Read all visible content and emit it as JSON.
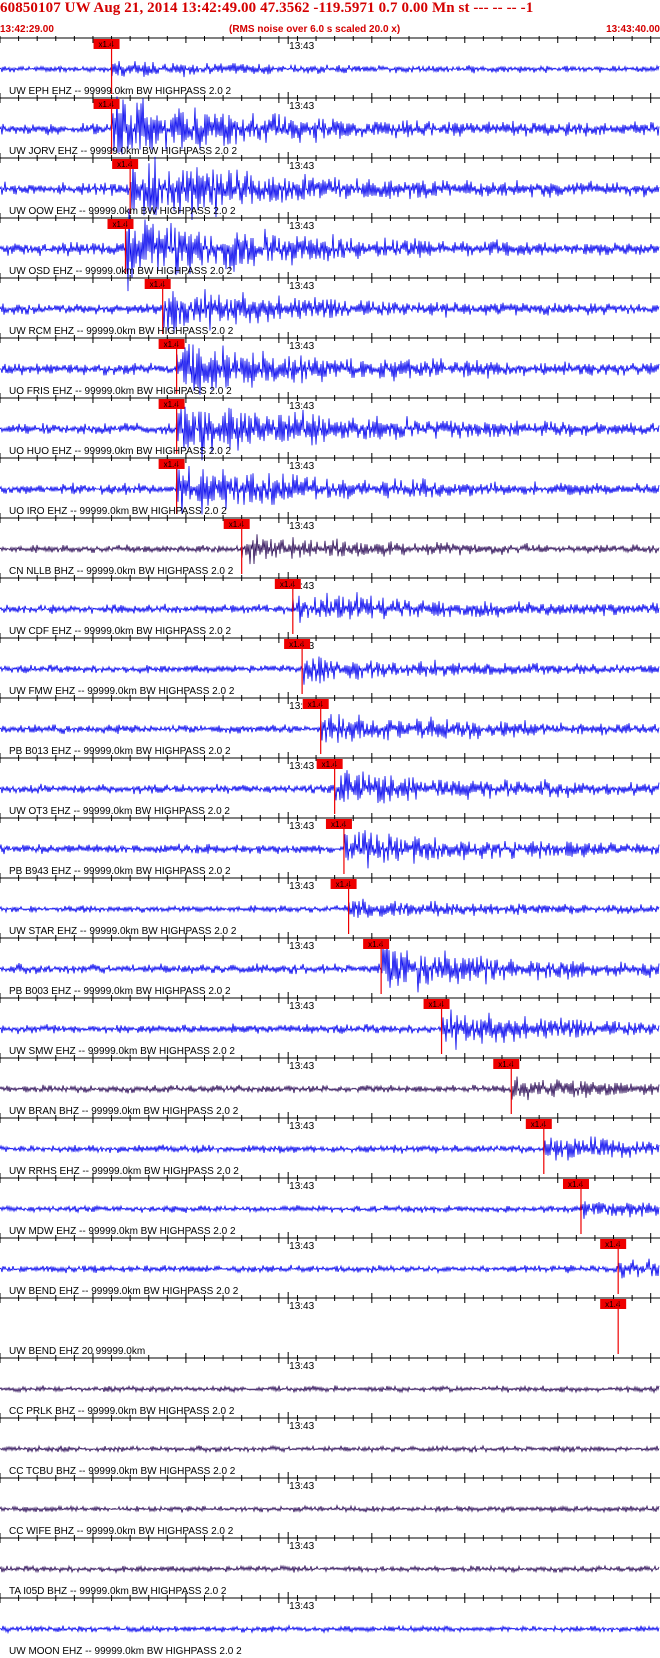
{
  "header": {
    "title": "60850107 UW Aug 21, 2014 13:42:49.00   47.3562 -119.5971  0.7 0.00 Mn st --- -- --  -1",
    "start_time": "13:42:29.00",
    "subtitle": "(RMS noise over 6.0 s scaled 20.0 x)",
    "end_time": "13:43:40.00"
  },
  "colors": {
    "header_text": "#d40000",
    "trace_blue": "#0000ee",
    "trace_purple": "#2a0a55",
    "pick": "#ee0000",
    "axis": "#000000"
  },
  "chart_data": {
    "type": "line",
    "title": "60850107 UW Aug 21, 2014 13:42:49.00",
    "x_unit": "seconds",
    "x_range": [
      "13:42:29.00",
      "13:43:40.00"
    ],
    "minute_tick_label": "13:43",
    "pick_label": "x1.4",
    "traces": [
      {
        "label": "UW EPH EHZ -- 99999.0km BW  HIGHPASS  2.0  2",
        "color": "blue",
        "pick_s": 12.0,
        "amp": 0.22
      },
      {
        "label": "UW JORV EHZ -- 99999.0km BW  HIGHPASS  2.0  2",
        "color": "blue",
        "pick_s": 12.0,
        "amp": 0.95
      },
      {
        "label": "UW OOW EHZ -- 99999.0km BW  HIGHPASS  2.0  2",
        "color": "blue",
        "pick_s": 14.0,
        "amp": 1.1
      },
      {
        "label": "UW OSD EHZ -- 99999.0km BW  HIGHPASS  2.0  2",
        "color": "blue",
        "pick_s": 13.5,
        "amp": 1.1
      },
      {
        "label": "UW RCM EHZ -- 99999.0km BW  HIGHPASS  2.0  2",
        "color": "blue",
        "pick_s": 17.5,
        "amp": 0.7
      },
      {
        "label": "UO FRIS EHZ -- 99999.0km BW  HIGHPASS  2.0  2",
        "color": "blue",
        "pick_s": 19.0,
        "amp": 0.95
      },
      {
        "label": "UO HUO EHZ -- 99999.0km BW  HIGHPASS  2.0  2",
        "color": "blue",
        "pick_s": 19.0,
        "amp": 0.95
      },
      {
        "label": "UO IRO EHZ -- 99999.0km BW  HIGHPASS  2.0  2",
        "color": "blue",
        "pick_s": 19.0,
        "amp": 0.8
      },
      {
        "label": "CN NLLB BHZ -- 99999.0km BW  HIGHPASS  2.0  2",
        "color": "purple",
        "pick_s": 26.0,
        "amp": 0.4
      },
      {
        "label": "UW CDF EHZ -- 99999.0km BW  HIGHPASS  2.0  2",
        "color": "blue",
        "pick_s": 31.5,
        "amp": 0.55
      },
      {
        "label": "UW FMW EHZ -- 99999.0km BW  HIGHPASS  2.0  2",
        "color": "blue",
        "pick_s": 32.5,
        "amp": 0.4
      },
      {
        "label": "PB B013 EHZ -- 99999.0km BW  HIGHPASS  2.0  2",
        "color": "blue",
        "pick_s": 34.5,
        "amp": 0.55
      },
      {
        "label": "UW OT3 EHZ -- 99999.0km BW  HIGHPASS  2.0  2",
        "color": "blue",
        "pick_s": 36.0,
        "amp": 0.6
      },
      {
        "label": "PB B943 EHZ -- 99999.0km BW  HIGHPASS  2.0  2",
        "color": "blue",
        "pick_s": 37.0,
        "amp": 0.6
      },
      {
        "label": "UW STAR EHZ -- 99999.0km BW  HIGHPASS  2.0  2",
        "color": "blue",
        "pick_s": 37.5,
        "amp": 0.3
      },
      {
        "label": "PB B003 EHZ -- 99999.0km BW  HIGHPASS  2.0  2",
        "color": "blue",
        "pick_s": 41.0,
        "amp": 0.7
      },
      {
        "label": "UW SMW EHZ -- 99999.0km BW  HIGHPASS  2.0  2",
        "color": "blue",
        "pick_s": 47.5,
        "amp": 0.55
      },
      {
        "label": "UW BRAN BHZ -- 99999.0km BW  HIGHPASS  2.0  2",
        "color": "purple",
        "pick_s": 55.0,
        "amp": 0.35
      },
      {
        "label": "UW RRHS EHZ -- 99999.0km BW  HIGHPASS  2.0  2",
        "color": "blue",
        "pick_s": 58.5,
        "amp": 0.4
      },
      {
        "label": "UW MDW EHZ -- 99999.0km BW  HIGHPASS  2.0  2",
        "color": "blue",
        "pick_s": 62.5,
        "amp": 0.25
      },
      {
        "label": "UW BEND EHZ -- 99999.0km BW  HIGHPASS  2.0  2",
        "color": "blue",
        "pick_s": 66.5,
        "amp": 0.3
      },
      {
        "label": "UW BEND EHZ 20 99999.0km",
        "color": "none",
        "pick_s": 66.5,
        "amp": 0.0
      },
      {
        "label": "CC PRLK BHZ -- 99999.0km BW  HIGHPASS  2.0  2",
        "color": "purple",
        "pick_s": null,
        "amp": 0.15
      },
      {
        "label": "CC TCBU BHZ -- 99999.0km BW  HIGHPASS  2.0  2",
        "color": "purple",
        "pick_s": null,
        "amp": 0.15
      },
      {
        "label": "CC WIFE BHZ -- 99999.0km BW  HIGHPASS  2.0  2",
        "color": "purple",
        "pick_s": null,
        "amp": 0.15
      },
      {
        "label": "TA I05D BHZ -- 99999.0km BW  HIGHPASS  2.0  2",
        "color": "purple",
        "pick_s": null,
        "amp": 0.15
      },
      {
        "label": "UW MOON EHZ -- 99999.0km BW  HIGHPASS  2.0  2",
        "color": "blue",
        "pick_s": null,
        "amp": 0.2
      }
    ]
  }
}
